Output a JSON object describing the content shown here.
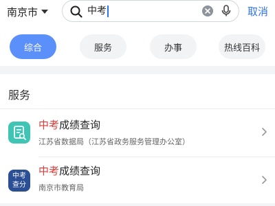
{
  "search": {
    "city": "南京市",
    "query": "中考",
    "cancel_label": "取消"
  },
  "tabs": [
    {
      "label": "综合",
      "active": true
    },
    {
      "label": "服务",
      "active": false
    },
    {
      "label": "办事",
      "active": false
    },
    {
      "label": "热线百科",
      "active": false
    }
  ],
  "section": {
    "title": "服务"
  },
  "results": [
    {
      "title_highlight": "中考",
      "title_rest": "成绩查询",
      "subtitle": "江苏省数据局（江苏省政务服务管理办公室）",
      "icon": "score-report-icon"
    },
    {
      "title_highlight": "中考",
      "title_rest": "成绩查询",
      "subtitle": "南京市教育局",
      "icon": "exam-query-icon",
      "icon_text_line1": "中考",
      "icon_text_line2": "查分"
    }
  ],
  "colors": {
    "accent": "#2f73f0",
    "tab_active": "#5b8ff9",
    "highlight": "#e53935"
  }
}
